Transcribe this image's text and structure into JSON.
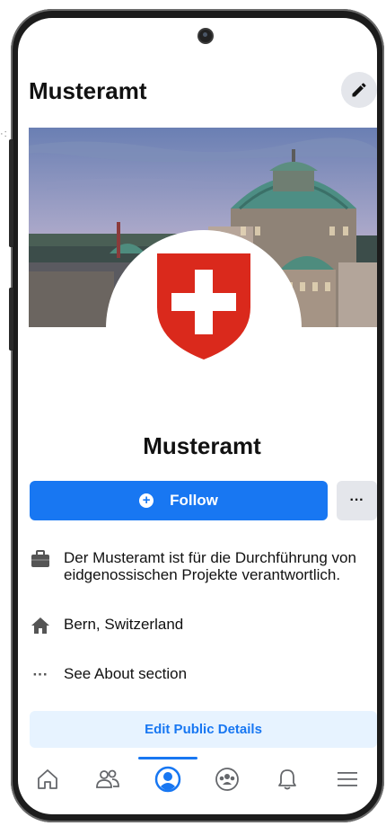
{
  "header": {
    "title": "Musteramt",
    "edit_icon": "pencil-icon"
  },
  "cover": {
    "image": "bern-federal-palace-cover-photo"
  },
  "profile": {
    "name": "Musteramt",
    "avatar": "swiss-coat-of-arms"
  },
  "actions": {
    "follow_label": "Follow",
    "more_label": "···"
  },
  "about": {
    "description": "Der Musteramt ist für die Durchführung von eidgenossischen Projekte verantwortlich.",
    "location": "Bern, Switzerland",
    "see_about": "See About section"
  },
  "edit_details_label": "Edit Public Details",
  "bottom_nav": {
    "items": [
      "home-icon",
      "friends-icon",
      "profile-icon",
      "groups-icon",
      "notifications-icon",
      "menu-icon"
    ],
    "active": "profile-icon"
  },
  "colors": {
    "brand_blue": "#1877f2",
    "swiss_red": "#da291c"
  }
}
